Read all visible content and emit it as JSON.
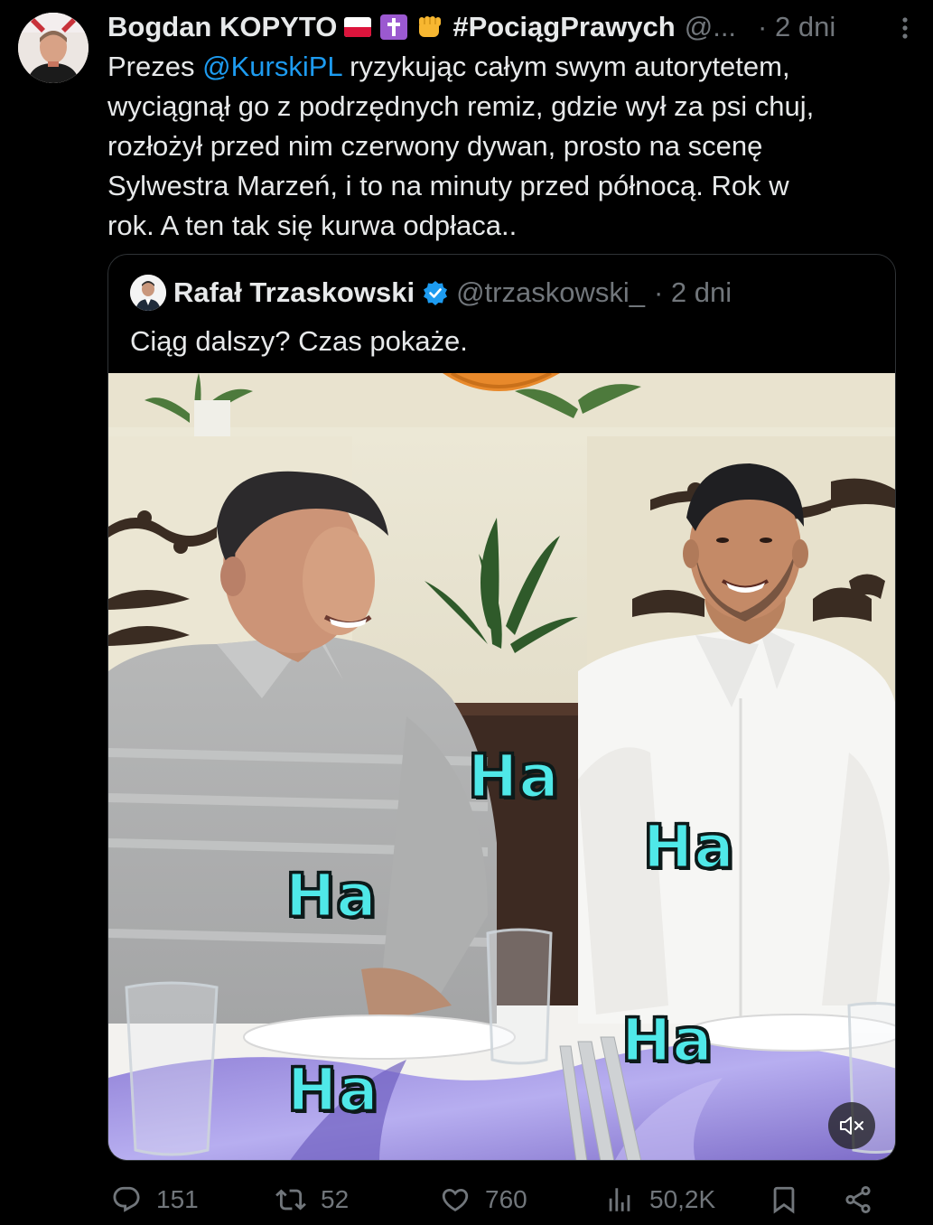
{
  "tweet": {
    "author_name": "Bogdan KOPYTO",
    "hashtag_name": "#PociągPrawych",
    "handle": "@...",
    "time": "· 2 dni",
    "text": {
      "line1_prefix": "Prezes ",
      "mention": "@KurskiPL",
      "line1_suffix": " ryzykując całym swym autorytetem,",
      "line2": "wyciągnął go z podrzędnych remiz, gdzie wył za psi chuj,",
      "line3": "rozłożył przed nim czerwony dywan, prosto na scenę",
      "line4": "Sylwestra Marzeń, i to na minuty przed północą. Rok w",
      "line5": "rok. A ten tak się kurwa odpłaca.."
    },
    "author_emojis": [
      "flag-poland",
      "latin-cross",
      "oncoming-fist"
    ]
  },
  "quote": {
    "name": "Rafał Trzaskowski",
    "verified": true,
    "handle": "@trzaskowski_",
    "time": "· 2 dni",
    "text": "Ciąg dalszy? Czas pokaże.",
    "video_captions": [
      "Ha",
      "Ha",
      "Ha",
      "Ha",
      "Ha"
    ]
  },
  "actions": {
    "reply_count": "151",
    "repost_count": "52",
    "like_count": "760",
    "views_count": "50,2K"
  },
  "colors": {
    "background": "#000000",
    "text": "#e7e9ea",
    "secondary": "#71767b",
    "accent": "#1d9bf0",
    "caption": "#4fe8e8"
  },
  "icons": {
    "more": "more-vertical-icon",
    "reply": "reply-icon",
    "repost": "repost-icon",
    "like": "heart-icon",
    "views": "views-icon",
    "bookmark": "bookmark-icon",
    "share": "share-icon",
    "mute": "mute-icon",
    "verified": "verified-badge-icon"
  }
}
